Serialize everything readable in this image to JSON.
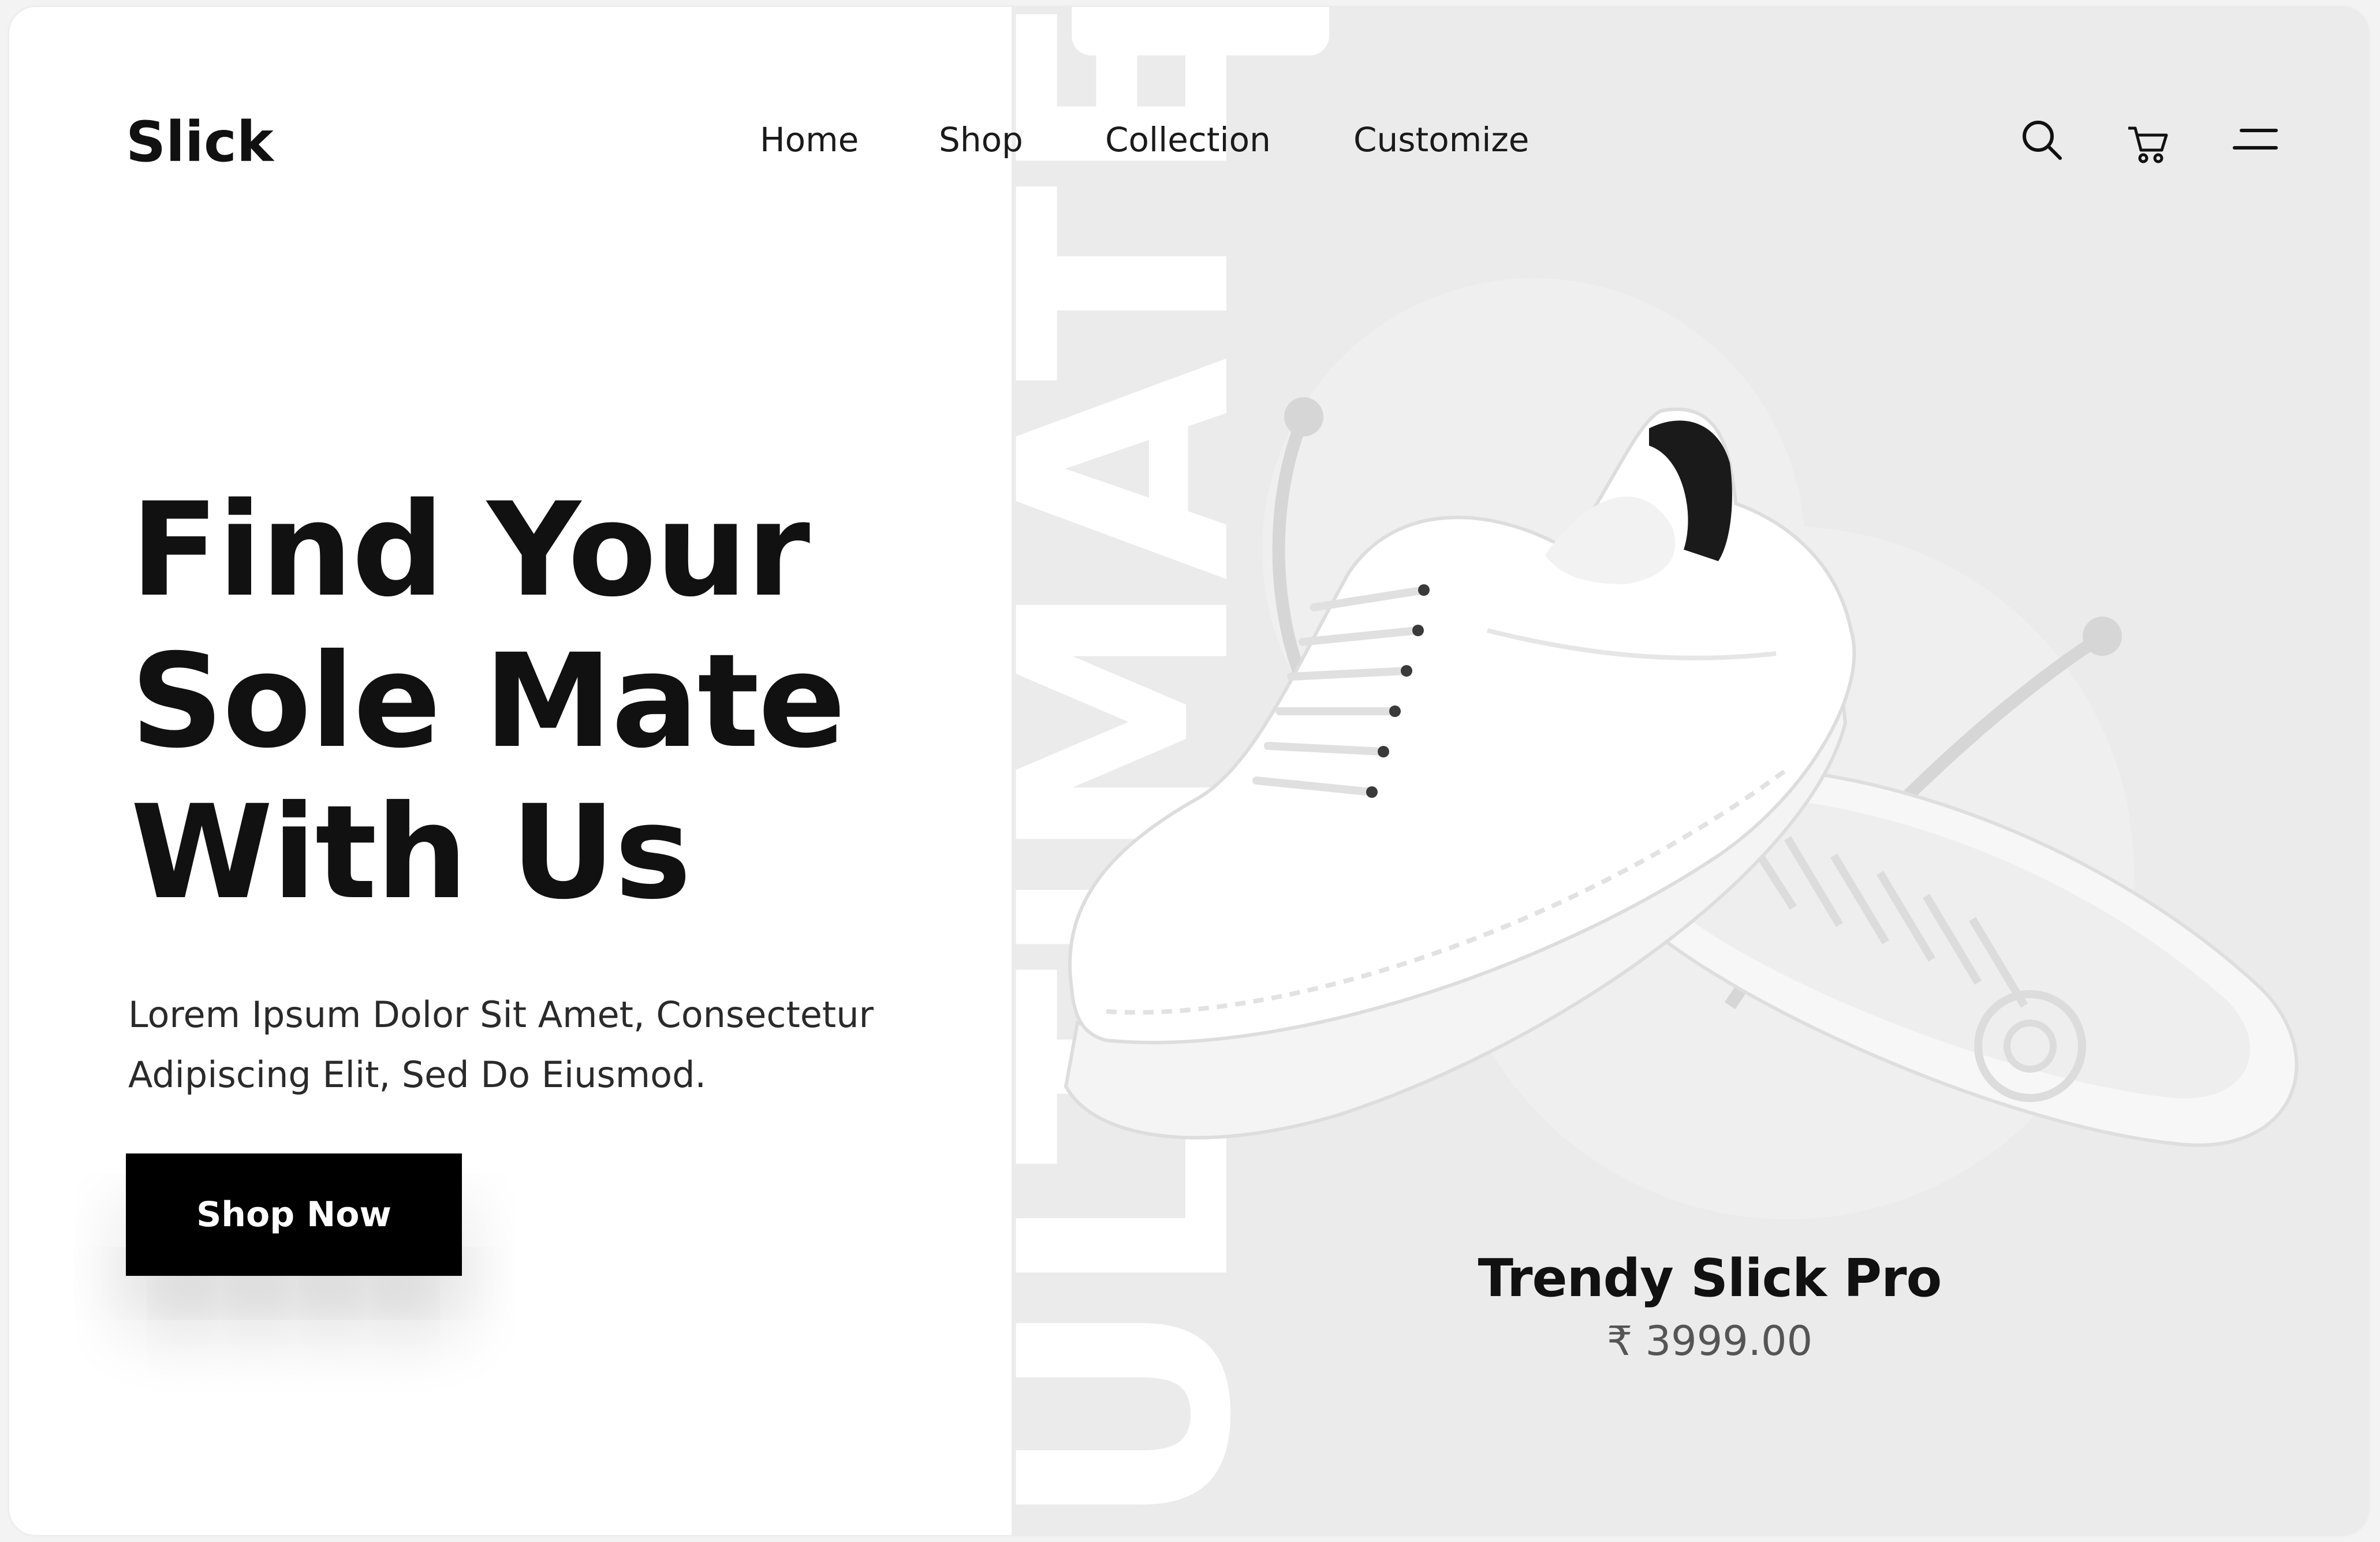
{
  "brand": {
    "name": "Slick"
  },
  "nav": {
    "items": [
      {
        "label": "Home"
      },
      {
        "label": "Shop"
      },
      {
        "label": "Collection"
      },
      {
        "label": "Customize"
      }
    ]
  },
  "header_icons": {
    "search": "search-icon",
    "cart": "cart-icon",
    "menu": "menu-icon"
  },
  "hero": {
    "title_lines": [
      "Find Your",
      "Sole Mate",
      "With Us"
    ],
    "description_lines": [
      "Lorem Ipsum Dolor Sit Amet, Consectetur",
      "Adipiscing Elit, Sed Do Eiusmod."
    ],
    "cta_label": "Shop Now"
  },
  "background_word": "ULTIMATE",
  "product": {
    "name": "Trendy Slick Pro",
    "price": "₹ 3999.00"
  },
  "colors": {
    "accent": "#000000",
    "panel": "#ebebeb",
    "background": "#ffffff"
  }
}
